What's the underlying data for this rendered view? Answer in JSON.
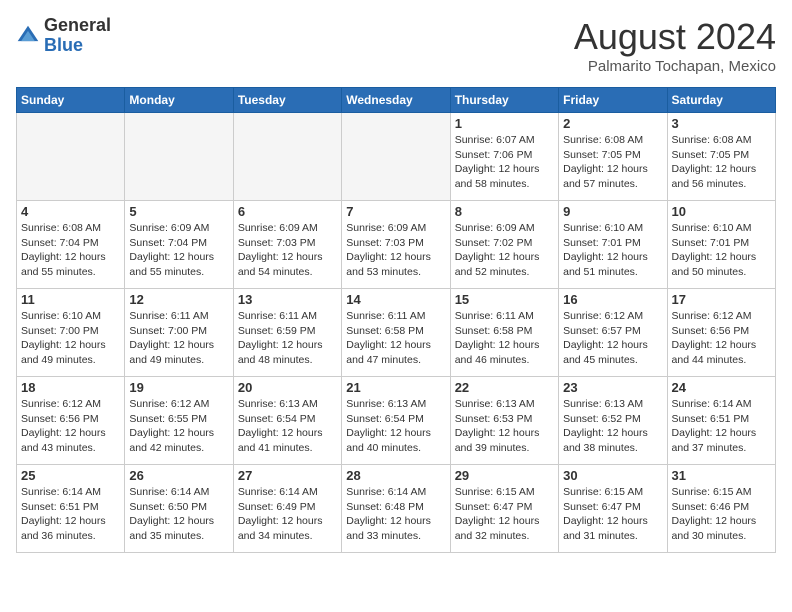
{
  "header": {
    "logo_general": "General",
    "logo_blue": "Blue",
    "month_title": "August 2024",
    "subtitle": "Palmarito Tochapan, Mexico"
  },
  "weekdays": [
    "Sunday",
    "Monday",
    "Tuesday",
    "Wednesday",
    "Thursday",
    "Friday",
    "Saturday"
  ],
  "weeks": [
    [
      {
        "day": "",
        "text": ""
      },
      {
        "day": "",
        "text": ""
      },
      {
        "day": "",
        "text": ""
      },
      {
        "day": "",
        "text": ""
      },
      {
        "day": "1",
        "text": "Sunrise: 6:07 AM\nSunset: 7:06 PM\nDaylight: 12 hours\nand 58 minutes."
      },
      {
        "day": "2",
        "text": "Sunrise: 6:08 AM\nSunset: 7:05 PM\nDaylight: 12 hours\nand 57 minutes."
      },
      {
        "day": "3",
        "text": "Sunrise: 6:08 AM\nSunset: 7:05 PM\nDaylight: 12 hours\nand 56 minutes."
      }
    ],
    [
      {
        "day": "4",
        "text": "Sunrise: 6:08 AM\nSunset: 7:04 PM\nDaylight: 12 hours\nand 55 minutes."
      },
      {
        "day": "5",
        "text": "Sunrise: 6:09 AM\nSunset: 7:04 PM\nDaylight: 12 hours\nand 55 minutes."
      },
      {
        "day": "6",
        "text": "Sunrise: 6:09 AM\nSunset: 7:03 PM\nDaylight: 12 hours\nand 54 minutes."
      },
      {
        "day": "7",
        "text": "Sunrise: 6:09 AM\nSunset: 7:03 PM\nDaylight: 12 hours\nand 53 minutes."
      },
      {
        "day": "8",
        "text": "Sunrise: 6:09 AM\nSunset: 7:02 PM\nDaylight: 12 hours\nand 52 minutes."
      },
      {
        "day": "9",
        "text": "Sunrise: 6:10 AM\nSunset: 7:01 PM\nDaylight: 12 hours\nand 51 minutes."
      },
      {
        "day": "10",
        "text": "Sunrise: 6:10 AM\nSunset: 7:01 PM\nDaylight: 12 hours\nand 50 minutes."
      }
    ],
    [
      {
        "day": "11",
        "text": "Sunrise: 6:10 AM\nSunset: 7:00 PM\nDaylight: 12 hours\nand 49 minutes."
      },
      {
        "day": "12",
        "text": "Sunrise: 6:11 AM\nSunset: 7:00 PM\nDaylight: 12 hours\nand 49 minutes."
      },
      {
        "day": "13",
        "text": "Sunrise: 6:11 AM\nSunset: 6:59 PM\nDaylight: 12 hours\nand 48 minutes."
      },
      {
        "day": "14",
        "text": "Sunrise: 6:11 AM\nSunset: 6:58 PM\nDaylight: 12 hours\nand 47 minutes."
      },
      {
        "day": "15",
        "text": "Sunrise: 6:11 AM\nSunset: 6:58 PM\nDaylight: 12 hours\nand 46 minutes."
      },
      {
        "day": "16",
        "text": "Sunrise: 6:12 AM\nSunset: 6:57 PM\nDaylight: 12 hours\nand 45 minutes."
      },
      {
        "day": "17",
        "text": "Sunrise: 6:12 AM\nSunset: 6:56 PM\nDaylight: 12 hours\nand 44 minutes."
      }
    ],
    [
      {
        "day": "18",
        "text": "Sunrise: 6:12 AM\nSunset: 6:56 PM\nDaylight: 12 hours\nand 43 minutes."
      },
      {
        "day": "19",
        "text": "Sunrise: 6:12 AM\nSunset: 6:55 PM\nDaylight: 12 hours\nand 42 minutes."
      },
      {
        "day": "20",
        "text": "Sunrise: 6:13 AM\nSunset: 6:54 PM\nDaylight: 12 hours\nand 41 minutes."
      },
      {
        "day": "21",
        "text": "Sunrise: 6:13 AM\nSunset: 6:54 PM\nDaylight: 12 hours\nand 40 minutes."
      },
      {
        "day": "22",
        "text": "Sunrise: 6:13 AM\nSunset: 6:53 PM\nDaylight: 12 hours\nand 39 minutes."
      },
      {
        "day": "23",
        "text": "Sunrise: 6:13 AM\nSunset: 6:52 PM\nDaylight: 12 hours\nand 38 minutes."
      },
      {
        "day": "24",
        "text": "Sunrise: 6:14 AM\nSunset: 6:51 PM\nDaylight: 12 hours\nand 37 minutes."
      }
    ],
    [
      {
        "day": "25",
        "text": "Sunrise: 6:14 AM\nSunset: 6:51 PM\nDaylight: 12 hours\nand 36 minutes."
      },
      {
        "day": "26",
        "text": "Sunrise: 6:14 AM\nSunset: 6:50 PM\nDaylight: 12 hours\nand 35 minutes."
      },
      {
        "day": "27",
        "text": "Sunrise: 6:14 AM\nSunset: 6:49 PM\nDaylight: 12 hours\nand 34 minutes."
      },
      {
        "day": "28",
        "text": "Sunrise: 6:14 AM\nSunset: 6:48 PM\nDaylight: 12 hours\nand 33 minutes."
      },
      {
        "day": "29",
        "text": "Sunrise: 6:15 AM\nSunset: 6:47 PM\nDaylight: 12 hours\nand 32 minutes."
      },
      {
        "day": "30",
        "text": "Sunrise: 6:15 AM\nSunset: 6:47 PM\nDaylight: 12 hours\nand 31 minutes."
      },
      {
        "day": "31",
        "text": "Sunrise: 6:15 AM\nSunset: 6:46 PM\nDaylight: 12 hours\nand 30 minutes."
      }
    ]
  ]
}
